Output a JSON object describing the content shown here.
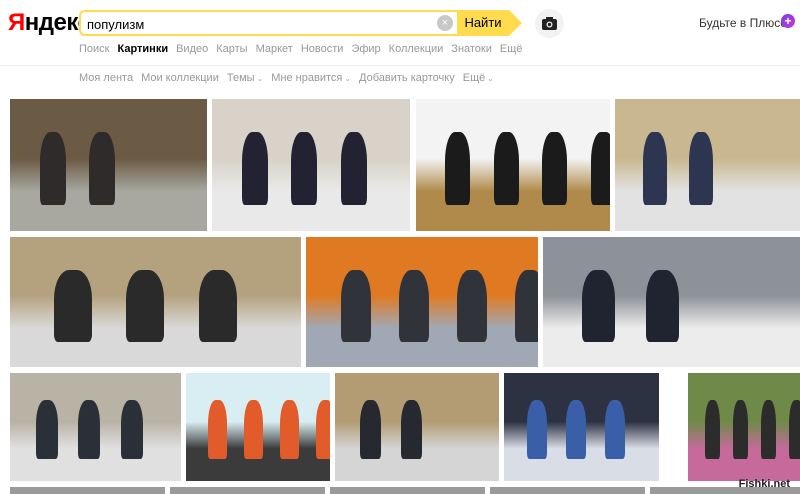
{
  "logo": {
    "first": "Я",
    "rest": "ндекс"
  },
  "search": {
    "value": "популизм",
    "find_label": "Найти"
  },
  "plus": {
    "label": "Будьте в Плюсе",
    "badge": "+"
  },
  "nav": [
    "Поиск",
    "Картинки",
    "Видео",
    "Карты",
    "Маркет",
    "Новости",
    "Эфир",
    "Коллекции",
    "Знатоки",
    "Ещё"
  ],
  "nav_active": 1,
  "subnav": [
    {
      "label": "Моя лента",
      "dropdown": false
    },
    {
      "label": "Мои коллекции",
      "dropdown": false
    },
    {
      "label": "Темы",
      "dropdown": true
    },
    {
      "label": "Мне нравится",
      "dropdown": true
    },
    {
      "label": "Добавить карточку",
      "dropdown": false
    },
    {
      "label": "Ещё",
      "dropdown": true
    }
  ],
  "thumbs": [
    {
      "name": "thumb-men-shovels-park",
      "colors": [
        "#6b5a44",
        "#2e2b2a",
        "#a8a8a0"
      ]
    },
    {
      "name": "thumb-man-vest-ice",
      "colors": [
        "#d8d2c8",
        "#223",
        "#e9e9e9"
      ]
    },
    {
      "name": "thumb-speaker-shovel",
      "colors": [
        "#f3f3f3",
        "#1b1b1b",
        "#b08a4a"
      ]
    },
    {
      "name": "thumb-archway-workers",
      "colors": [
        "#c9b88f",
        "#2e3550",
        "#e2e2e2"
      ]
    },
    {
      "name": "thumb-archway-men",
      "colors": [
        "#b4a27e",
        "#2a2a2a",
        "#d9d9d9"
      ]
    },
    {
      "name": "thumb-orange-snowplow",
      "colors": [
        "#e07a22",
        "#30333a",
        "#a0a8b5"
      ]
    },
    {
      "name": "thumb-car-workers",
      "colors": [
        "#8d9199",
        "#1f2430",
        "#ececec"
      ]
    },
    {
      "name": "thumb-tractor-workers",
      "colors": [
        "#b9b3a6",
        "#2b3038",
        "#e0e0e0"
      ]
    },
    {
      "name": "thumb-cartoon-shovel",
      "colors": [
        "#d9eef3",
        "#e25b2a",
        "#3b3b3b"
      ]
    },
    {
      "name": "thumb-street-team",
      "colors": [
        "#b39c74",
        "#262a30",
        "#d5d5d5"
      ]
    },
    {
      "name": "thumb-evening-man",
      "colors": [
        "#2c3242",
        "#3a5fa8",
        "#d9dde5"
      ]
    },
    {
      "name": "thumb-garden-people",
      "colors": [
        "#6f8a48",
        "#2c2c2c",
        "#c56a9b"
      ]
    }
  ],
  "footer": {
    "brand": "Fishki.net"
  }
}
